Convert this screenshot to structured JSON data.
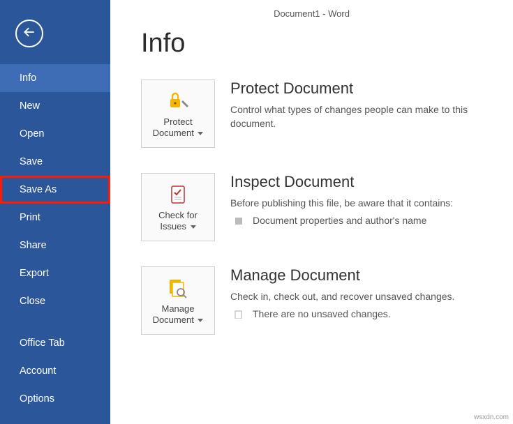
{
  "window_title": "Document1 - Word",
  "accent_color": "#2b579a",
  "sidebar": {
    "items": [
      {
        "label": "Info",
        "selected": true
      },
      {
        "label": "New"
      },
      {
        "label": "Open"
      },
      {
        "label": "Save"
      },
      {
        "label": "Save As",
        "highlighted": true
      },
      {
        "label": "Print"
      },
      {
        "label": "Share"
      },
      {
        "label": "Export"
      },
      {
        "label": "Close"
      }
    ],
    "footer_items": [
      {
        "label": "Office Tab"
      },
      {
        "label": "Account"
      },
      {
        "label": "Options"
      }
    ]
  },
  "page": {
    "title": "Info",
    "sections": [
      {
        "tile_label": "Protect Document",
        "heading": "Protect Document",
        "desc": "Control what types of changes people can make to this document."
      },
      {
        "tile_label": "Check for Issues",
        "heading": "Inspect Document",
        "desc": "Before publishing this file, be aware that it contains:",
        "bullet": "Document properties and author's name"
      },
      {
        "tile_label": "Manage Document",
        "heading": "Manage Document",
        "desc": "Check in, check out, and recover unsaved changes.",
        "bullet": "There are no unsaved changes."
      }
    ]
  },
  "watermark": "wsxdn.com"
}
